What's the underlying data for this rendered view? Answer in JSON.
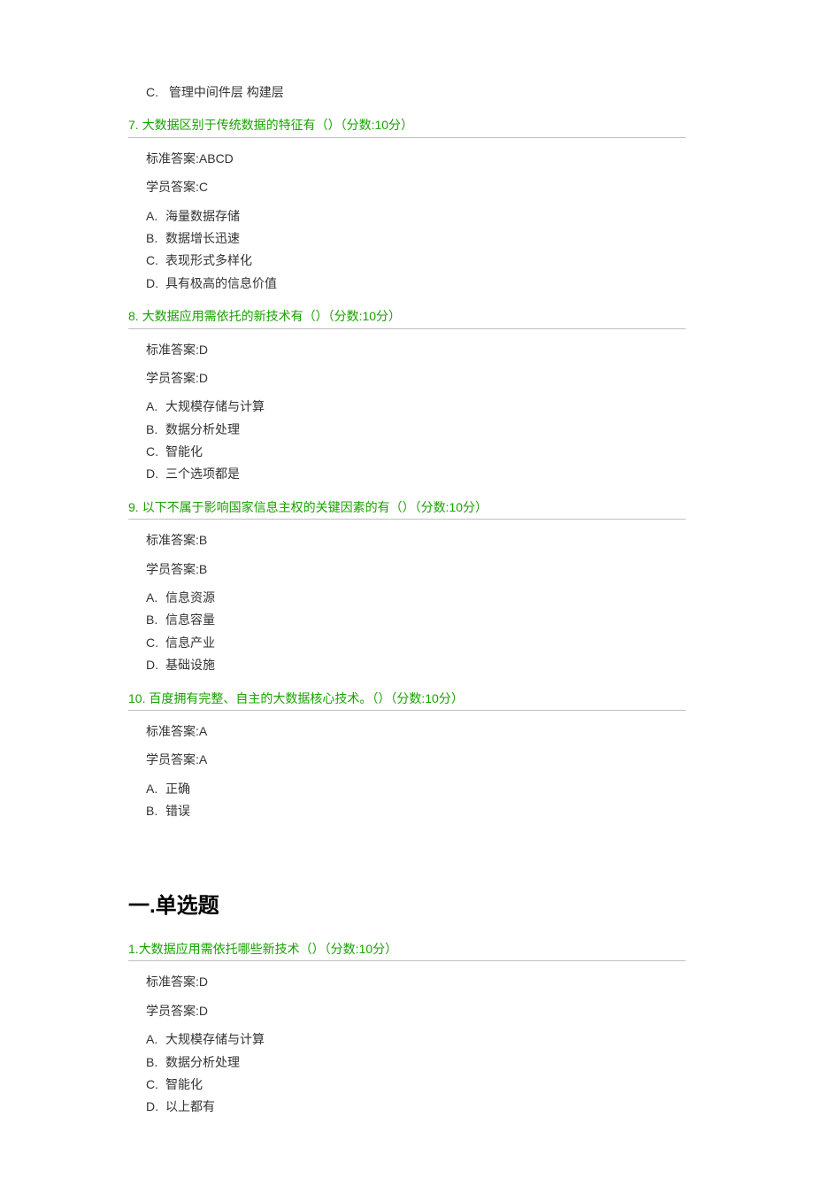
{
  "questions": [
    {
      "options_only": true,
      "options": [
        {
          "letter": "C.",
          "text": "管理中间件层 构建层"
        }
      ]
    },
    {
      "number": "7.",
      "text": "大数据区别于传统数据的特征有（）（分数:10分）",
      "standard_label": "标准答案:",
      "standard_answer": "ABCD",
      "student_label": "学员答案:",
      "student_answer": "C",
      "options": [
        {
          "letter": "A.",
          "text": "海量数据存储"
        },
        {
          "letter": "B.",
          "text": "数据增长迅速"
        },
        {
          "letter": "C.",
          "text": "表现形式多样化"
        },
        {
          "letter": "D.",
          "text": "具有极高的信息价值"
        }
      ]
    },
    {
      "number": "8.",
      "text": "大数据应用需依托的新技术有（）（分数:10分）",
      "standard_label": "标准答案:",
      "standard_answer": "D",
      "student_label": "学员答案:",
      "student_answer": "D",
      "options": [
        {
          "letter": "A.",
          "text": "大规模存储与计算"
        },
        {
          "letter": "B.",
          "text": "数据分析处理"
        },
        {
          "letter": "C.",
          "text": "智能化"
        },
        {
          "letter": "D.",
          "text": "三个选项都是"
        }
      ]
    },
    {
      "number": "9.",
      "text": "以下不属于影响国家信息主权的关键因素的有（）（分数:10分）",
      "standard_label": "标准答案:",
      "standard_answer": "B",
      "student_label": "学员答案:",
      "student_answer": "B",
      "options": [
        {
          "letter": "A.",
          "text": "信息资源"
        },
        {
          "letter": "B.",
          "text": "信息容量"
        },
        {
          "letter": "C.",
          "text": "信息产业"
        },
        {
          "letter": "D.",
          "text": "基础设施"
        }
      ]
    },
    {
      "number": "10.",
      "text": "百度拥有完整、自主的大数据核心技术。（）（分数:10分）",
      "standard_label": "标准答案:",
      "standard_answer": "A",
      "student_label": "学员答案:",
      "student_answer": "A",
      "options": [
        {
          "letter": "A.",
          "text": "正确"
        },
        {
          "letter": "B.",
          "text": "错误"
        }
      ]
    }
  ],
  "section_heading": "一.单选题",
  "questions2": [
    {
      "number": "1.",
      "text": "大数据应用需依托哪些新技术（）（分数:10分）",
      "standard_label": "标准答案:",
      "standard_answer": "D",
      "student_label": "学员答案:",
      "student_answer": "D",
      "options": [
        {
          "letter": "A.",
          "text": "大规模存储与计算"
        },
        {
          "letter": "B.",
          "text": "数据分析处理"
        },
        {
          "letter": "C.",
          "text": "智能化"
        },
        {
          "letter": "D.",
          "text": "以上都有"
        }
      ]
    }
  ]
}
